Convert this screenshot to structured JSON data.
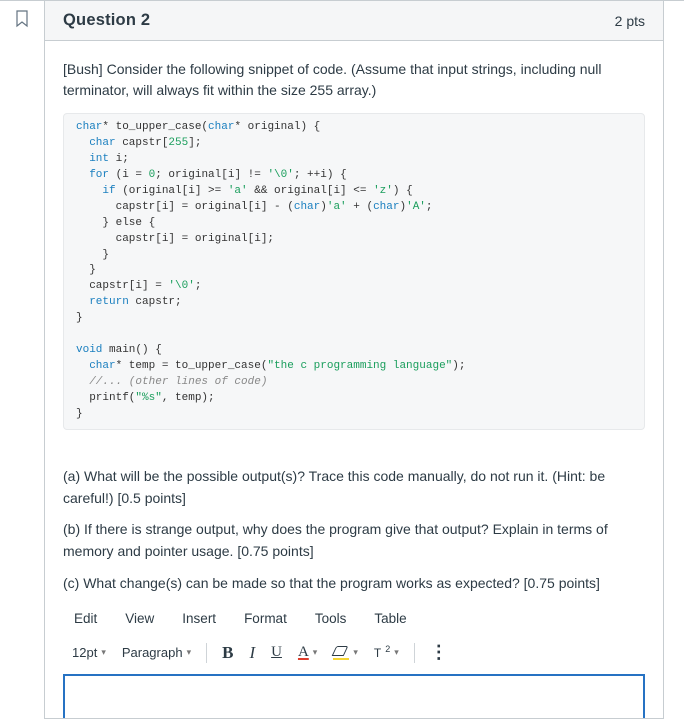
{
  "header": {
    "title": "Question 2",
    "points": "2 pts"
  },
  "prompt": "[Bush] Consider the following snippet of code. (Assume that input strings, including null terminator, will always fit within the size 255 array.)",
  "code": {
    "sig_ty1": "char",
    "sig_name": "* to_upper_case(",
    "sig_ty2": "char",
    "sig_rest": "* original) {",
    "decl1_ty": "char",
    "decl1_rest": " capstr[",
    "decl1_num": "255",
    "decl1_end": "];",
    "decl2_ty": "int",
    "decl2_rest": " i;",
    "for_kw": "for",
    "for_rest1": " (i = ",
    "for_zero": "0",
    "for_rest2": "; original[i] != ",
    "for_nul": "'\\0'",
    "for_rest3": "; ++i) {",
    "if_kw": "if",
    "if_rest1": " (original[i] >= ",
    "ch_a": "'a'",
    "if_amp": " && original[i] <= ",
    "ch_z": "'z'",
    "if_rest2": ") {",
    "asgn1a": "capstr[i] = original[i] - (",
    "cast1": "char",
    "asgn1b": ")",
    "ch_a2": "'a'",
    "asgn1c": " + (",
    "cast2": "char",
    "asgn1d": ")",
    "ch_A": "'A'",
    "asgn1e": ";",
    "else_kw": "} else {",
    "asgn2": "capstr[i] = original[i];",
    "close1": "}",
    "close2": "}",
    "asgn3a": "capstr[i] = ",
    "asgn3_nul": "'\\0'",
    "asgn3b": ";",
    "ret_kw": "return",
    "ret_rest": " capstr;",
    "close3": "}",
    "main_ty": "void",
    "main_rest": " main() {",
    "m_decl_ty": "char",
    "m_decl_rest": "* temp = to_upper_case(",
    "m_str": "\"the c programming language\"",
    "m_decl_end": ");",
    "cm": "//... (other lines of code)",
    "pr1": "printf(",
    "pr_str": "\"%s\"",
    "pr2": ", temp);",
    "close4": "}"
  },
  "subparts": {
    "a": "(a) What will be the possible output(s)? Trace this code manually, do not run it. (Hint: be careful!) [0.5 points]",
    "b": "(b) If there is strange output, why does the program give that output? Explain in terms of memory and pointer usage. [0.75 points]",
    "c": "(c) What change(s) can be made so that the program works as expected? [0.75 points]"
  },
  "editor": {
    "menu": {
      "edit": "Edit",
      "view": "View",
      "insert": "Insert",
      "format": "Format",
      "tools": "Tools",
      "table": "Table"
    },
    "tb": {
      "fontsize": "12pt",
      "block": "Paragraph",
      "bold": "B",
      "italic": "I",
      "underline": "U",
      "color": "A",
      "super": "T",
      "super2": "2",
      "more": "⋮"
    }
  }
}
